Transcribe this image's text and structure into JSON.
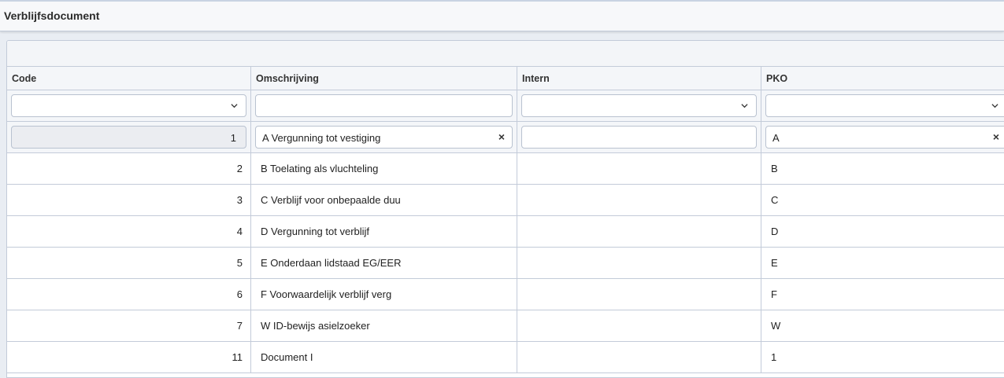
{
  "window": {
    "title": "Verblijfsdocument"
  },
  "columns": [
    "Code",
    "Omschrijving",
    "Intern",
    "PKO"
  ],
  "edit_row": {
    "code": "1",
    "omschrijving": "A Vergunning tot vestiging",
    "intern": "",
    "pko": "A"
  },
  "rows": [
    {
      "code": "2",
      "omschrijving": "B Toelating als vluchteling",
      "intern": "",
      "pko": "B"
    },
    {
      "code": "3",
      "omschrijving": "C Verblijf voor onbepaalde duu",
      "intern": "",
      "pko": "C"
    },
    {
      "code": "4",
      "omschrijving": "D Vergunning tot verblijf",
      "intern": "",
      "pko": "D"
    },
    {
      "code": "5",
      "omschrijving": "E Onderdaan lidstaad EG/EER",
      "intern": "",
      "pko": "E"
    },
    {
      "code": "6",
      "omschrijving": "F Voorwaardelijk verblijf verg",
      "intern": "",
      "pko": "F"
    },
    {
      "code": "7",
      "omschrijving": "W ID-bewijs asielzoeker",
      "intern": "",
      "pko": "W"
    },
    {
      "code": "11",
      "omschrijving": "Document I",
      "intern": "",
      "pko": "1"
    }
  ],
  "icons": {
    "dropdown": "chevron-down-icon",
    "clear": "clear-icon"
  },
  "colors": {
    "border": "#c3cbd9",
    "header_bg": "#f4f6f9",
    "page_bg": "#e9edf3"
  }
}
